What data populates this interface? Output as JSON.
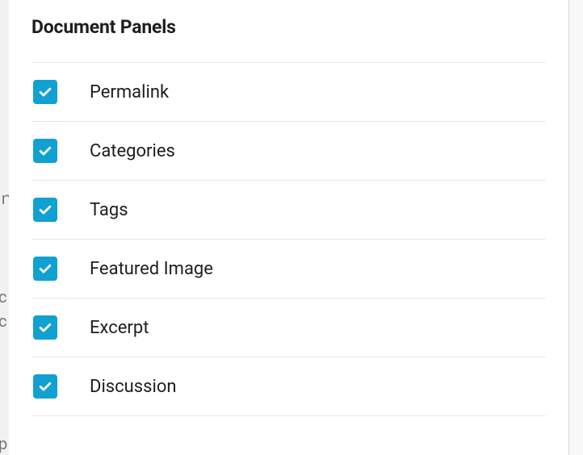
{
  "section_title": "Document Panels",
  "options": [
    {
      "id": "permalink",
      "label": "Permalink",
      "checked": true
    },
    {
      "id": "categories",
      "label": "Categories",
      "checked": true
    },
    {
      "id": "tags",
      "label": "Tags",
      "checked": true
    },
    {
      "id": "featured-image",
      "label": "Featured Image",
      "checked": true
    },
    {
      "id": "excerpt",
      "label": "Excerpt",
      "checked": true
    },
    {
      "id": "discussion",
      "label": "Discussion",
      "checked": true
    }
  ],
  "colors": {
    "accent": "#11a0d2"
  }
}
